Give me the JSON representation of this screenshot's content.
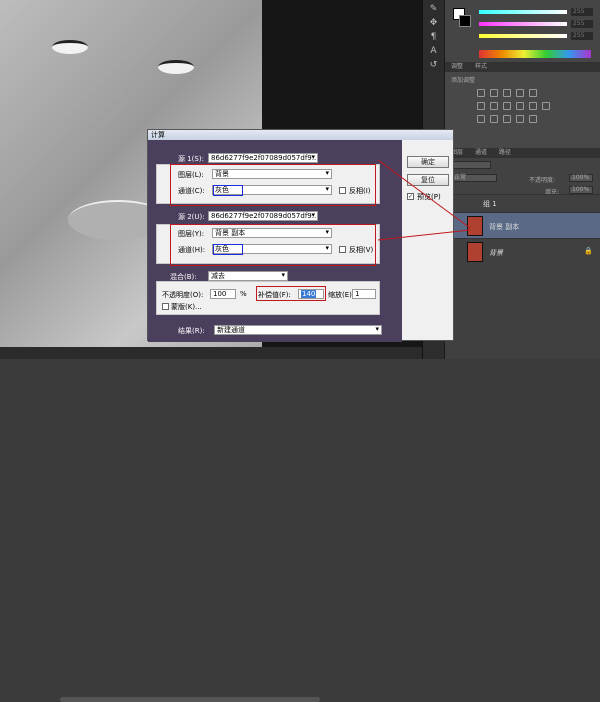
{
  "right_panel": {
    "slider_values": [
      "255",
      "255",
      "255"
    ],
    "tabs_top": [
      "调整",
      "样式"
    ],
    "adjust_label": "添加调整",
    "layers_tabs": [
      "图层",
      "通道",
      "路径"
    ],
    "blend_mode": "正常",
    "opacity_label": "不透明度:",
    "opacity_value": "100%",
    "fill_label": "填充:",
    "fill_value": "100%",
    "layers": [
      {
        "name": "组 1"
      },
      {
        "name": "背景 副本"
      },
      {
        "name": "背景"
      }
    ]
  },
  "dialog": {
    "title": "计算",
    "source1_label": "源 1(S):",
    "source1_value": "86d6277f9e2f07089d057df9...",
    "layer1_label": "图层(L):",
    "layer1_value": "背景",
    "channel1_label": "通道(C):",
    "channel1_value": "灰色",
    "invert1_label": "反相(I)",
    "source2_label": "源 2(U):",
    "source2_value": "86d6277f9e2f07089d057df9...",
    "layer2_label": "图层(Y):",
    "layer2_value": "背景 副本",
    "channel2_label": "通道(H):",
    "channel2_value": "灰色",
    "invert2_label": "反相(V)",
    "blend_label": "混合(B):",
    "blend_value": "减去",
    "opacity_label": "不透明度(O):",
    "opacity_value": "100",
    "opacity_unit": "%",
    "offset_label": "补偿值(F):",
    "offset_value": "140",
    "scale_label": "缩放(E):",
    "scale_value": "1",
    "mask_label": "蒙版(K)...",
    "result_label": "结果(R):",
    "result_value": "新建通道",
    "ok_label": "确定",
    "reset_label": "复位",
    "preview_label": "预览(P)"
  }
}
